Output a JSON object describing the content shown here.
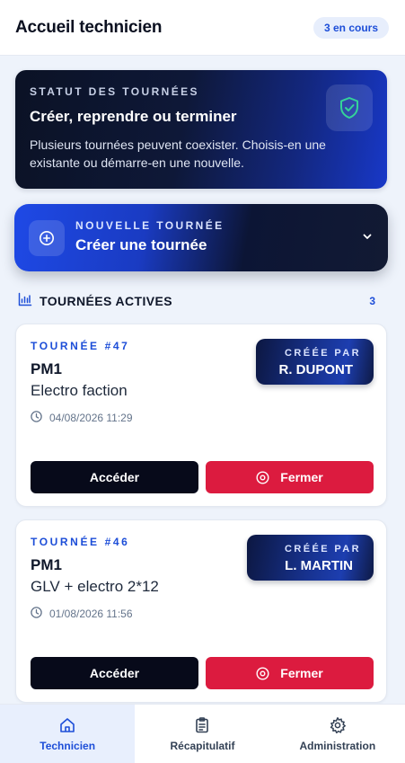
{
  "header": {
    "title": "Accueil technicien",
    "badge": "3 en cours"
  },
  "status_card": {
    "eyebrow": "STATUT DES TOURNÉES",
    "title": "Créer, reprendre ou terminer",
    "description": "Plusieurs tournées peuvent coexister. Choisis-en une existante ou démarre-en une nouvelle.",
    "icon": "shield-check-icon"
  },
  "new_tour": {
    "eyebrow": "NOUVELLE TOURNÉE",
    "title": "Créer une tournée",
    "icon": "plus-circle-icon"
  },
  "section": {
    "title": "TOURNÉES ACTIVES",
    "count": "3",
    "icon": "chart-icon"
  },
  "tours": [
    {
      "number": "TOURNÉE #47",
      "code": "PM1",
      "name": "Electro faction",
      "date": "04/08/2026 11:29",
      "creator_label": "CRÉÉE PAR",
      "creator": "R. DUPONT",
      "access_label": "Accéder",
      "close_label": "Fermer"
    },
    {
      "number": "TOURNÉE #46",
      "code": "PM1",
      "name": "GLV + electro 2*12",
      "date": "01/08/2026 11:56",
      "creator_label": "CRÉÉE PAR",
      "creator": "L. MARTIN",
      "access_label": "Accéder",
      "close_label": "Fermer"
    }
  ],
  "tabs": [
    {
      "label": "Technicien",
      "icon": "home-icon",
      "active": true
    },
    {
      "label": "Récapitulatif",
      "icon": "clipboard-icon",
      "active": false
    },
    {
      "label": "Administration",
      "icon": "gear-icon",
      "active": false
    }
  ],
  "colors": {
    "accent": "#1d4ed8",
    "danger": "#dc1b3f",
    "dark": "#070a1a"
  }
}
